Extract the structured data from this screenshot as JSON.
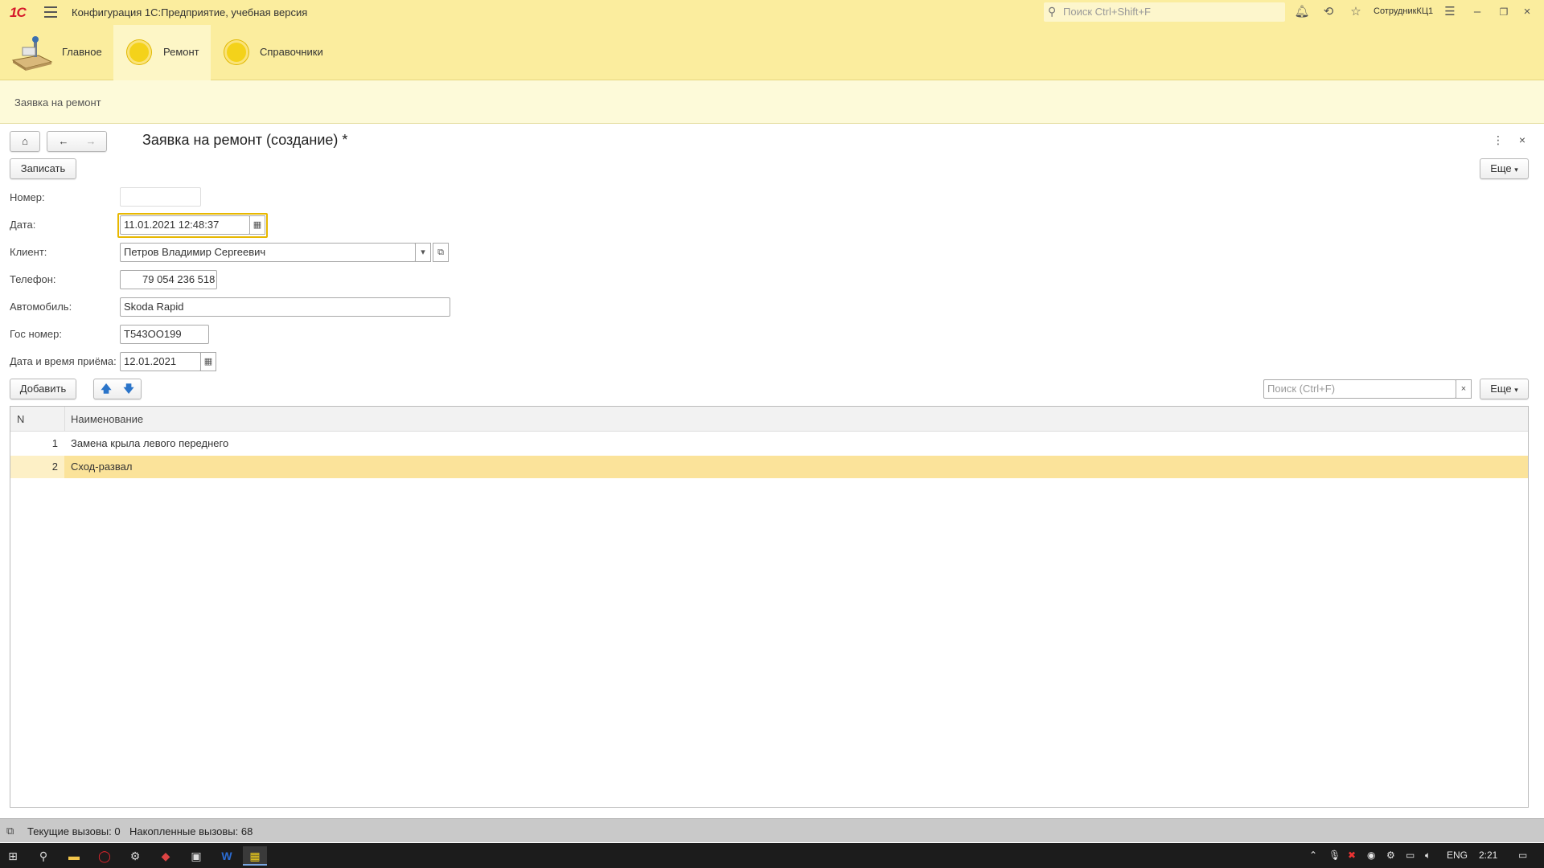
{
  "titlebar": {
    "logo": "1С",
    "title": "Конфигурация 1С:Предприятие, учебная версия",
    "search_placeholder": "Поиск Ctrl+Shift+F",
    "username": "СотрудникКЦ1"
  },
  "sections": [
    {
      "label": "Главное",
      "icon": "home-desk-icon"
    },
    {
      "label": "Ремонт",
      "icon": "coin-icon",
      "active": true
    },
    {
      "label": "Справочники",
      "icon": "coin-icon"
    }
  ],
  "subpanel": {
    "link": "Заявка на ремонт"
  },
  "form": {
    "title": "Заявка на ремонт (создание) *",
    "save_button": "Записать",
    "more_button": "Еще",
    "fields": {
      "number": {
        "label": "Номер:",
        "value": ""
      },
      "date": {
        "label": "Дата:",
        "value": "11.01.2021 12:48:37"
      },
      "client": {
        "label": "Клиент:",
        "value": "Петров Владимир Сергеевич"
      },
      "phone": {
        "label": "Телефон:",
        "value": "79 054 236 518"
      },
      "car": {
        "label": "Автомобиль:",
        "value": "Skoda Rapid"
      },
      "plate": {
        "label": "Гос номер:",
        "value": "Т543ОО199"
      },
      "reception": {
        "label": "Дата и время приёма:",
        "value": "12.01.2021"
      }
    }
  },
  "table_toolbar": {
    "add_button": "Добавить",
    "search_placeholder": "Поиск (Ctrl+F)",
    "more_button": "Еще"
  },
  "table": {
    "columns": [
      "N",
      "Наименование"
    ],
    "rows": [
      {
        "n": "1",
        "name": "Замена крыла левого переднего"
      },
      {
        "n": "2",
        "name": "Сход-развал",
        "selected": true
      }
    ]
  },
  "statusbar": {
    "current_calls": "Текущие вызовы: 0",
    "accumulated_calls": "Накопленные вызовы: 68"
  },
  "taskbar": {
    "lang": "ENG",
    "time": "2:21"
  },
  "colors": {
    "header_bg": "#fbed9e",
    "selected_row": "#fbe39a",
    "focus_border": "#e8b800"
  }
}
